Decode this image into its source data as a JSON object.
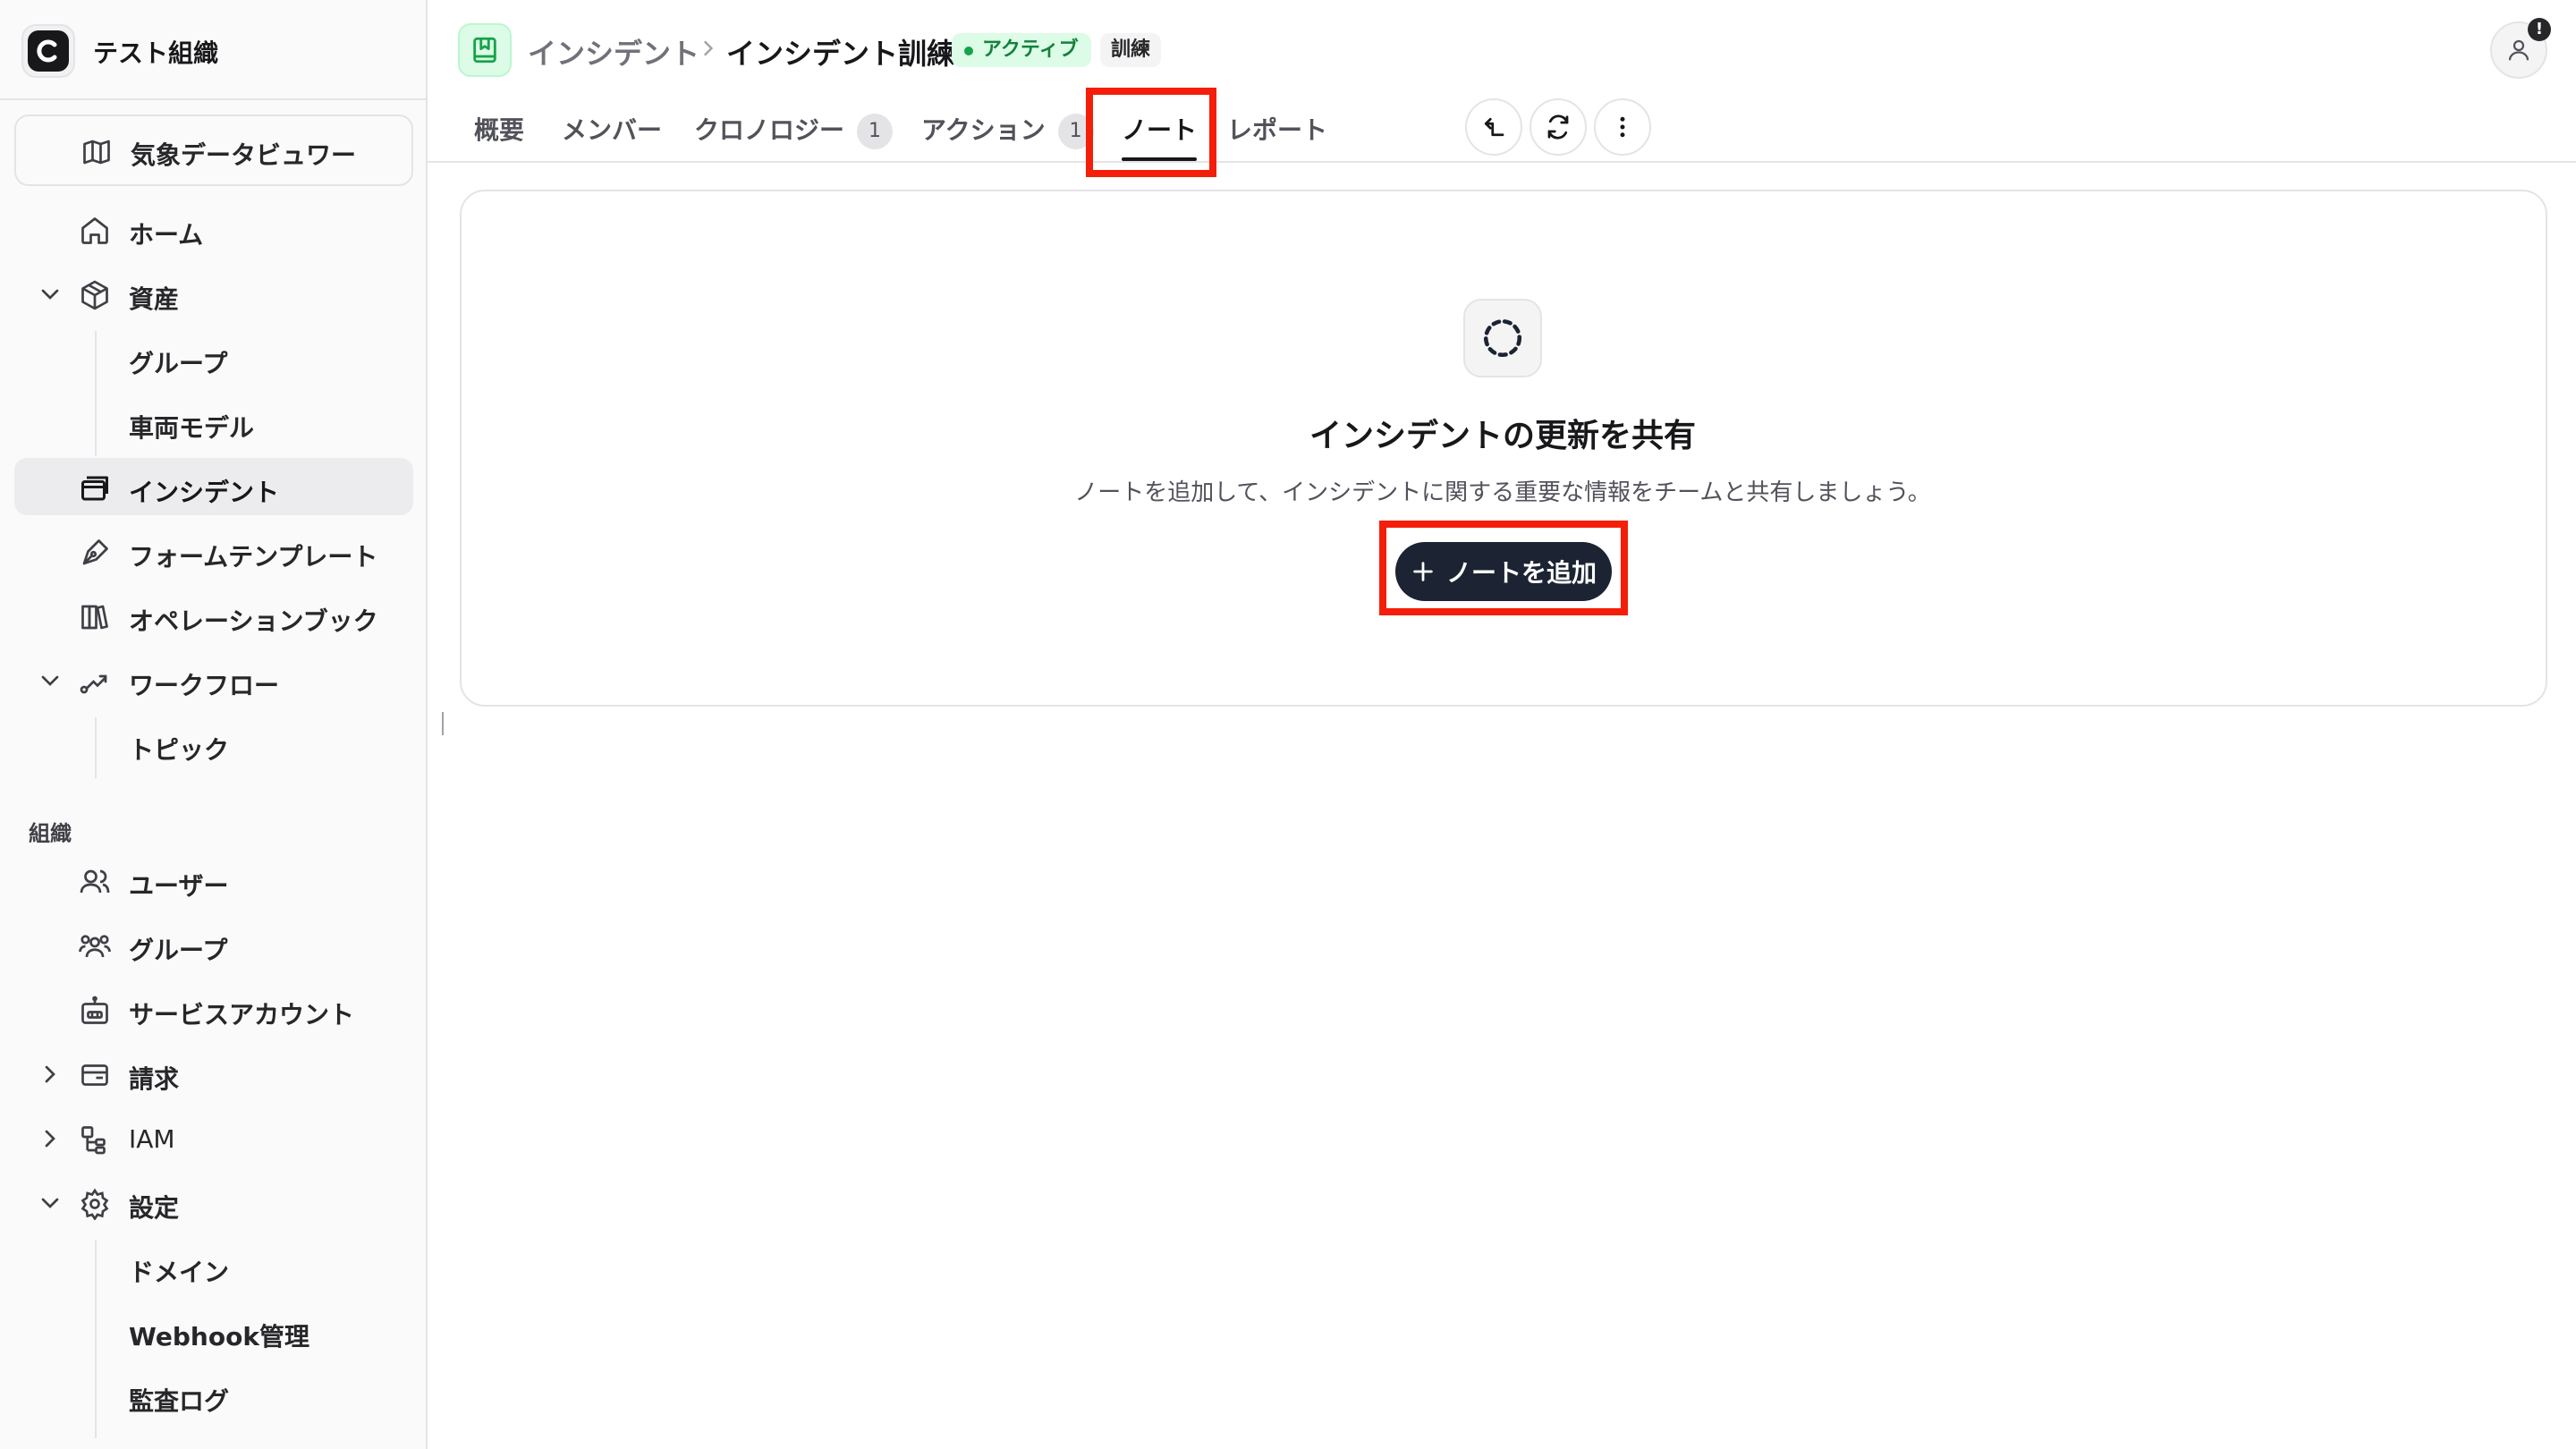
{
  "sidebar": {
    "org_name": "テスト組織",
    "weather_viewer": "気象データビュワー",
    "items": [
      {
        "label": "ホーム",
        "icon": "home-icon"
      },
      {
        "label": "資産",
        "icon": "box-icon",
        "chevron": "chevron-down-icon"
      },
      {
        "label": "グループ"
      },
      {
        "label": "車両モデル"
      },
      {
        "label": "インシデント",
        "icon": "incident-icon",
        "active": true
      },
      {
        "label": "フォームテンプレート",
        "icon": "pen-icon"
      },
      {
        "label": "オペレーションブック",
        "icon": "books-icon"
      },
      {
        "label": "ワークフロー",
        "icon": "workflow-icon",
        "chevron": "chevron-down-icon"
      },
      {
        "label": "トピック"
      }
    ],
    "org_section": {
      "title": "組織",
      "items": [
        {
          "label": "ユーザー",
          "icon": "users-icon"
        },
        {
          "label": "グループ",
          "icon": "group-icon"
        },
        {
          "label": "サービスアカウント",
          "icon": "bot-icon"
        },
        {
          "label": "請求",
          "icon": "wallet-icon",
          "chevron": "chevron-right-icon"
        },
        {
          "label": "IAM",
          "icon": "iam-icon",
          "chevron": "chevron-right-icon"
        },
        {
          "label": "設定",
          "icon": "gear-icon",
          "chevron": "chevron-down-icon"
        },
        {
          "label": "ドメイン"
        },
        {
          "label": "Webhook管理"
        },
        {
          "label": "監査ログ"
        }
      ]
    }
  },
  "header": {
    "breadcrumb_parent": "インシデント",
    "breadcrumb_current": "インシデント訓練",
    "status_badge": "アクティブ",
    "type_badge": "訓練",
    "notification_count": "!"
  },
  "tabs": [
    {
      "label": "概要"
    },
    {
      "label": "メンバー"
    },
    {
      "label": "クロノロジー",
      "count": "1"
    },
    {
      "label": "アクション",
      "count": "1"
    },
    {
      "label": "ノート",
      "active": true
    },
    {
      "label": "レポート"
    }
  ],
  "empty_state": {
    "title": "インシデントの更新を共有",
    "description": "ノートを追加して、インシデントに関する重要な情報をチームと共有しましょう。",
    "button_label": "ノートを追加"
  },
  "colors": {
    "accent_dark": "#1c2433",
    "active_badge_bg": "#dcfce7",
    "active_badge_text": "#15803d",
    "highlight": "#f41e0a"
  }
}
